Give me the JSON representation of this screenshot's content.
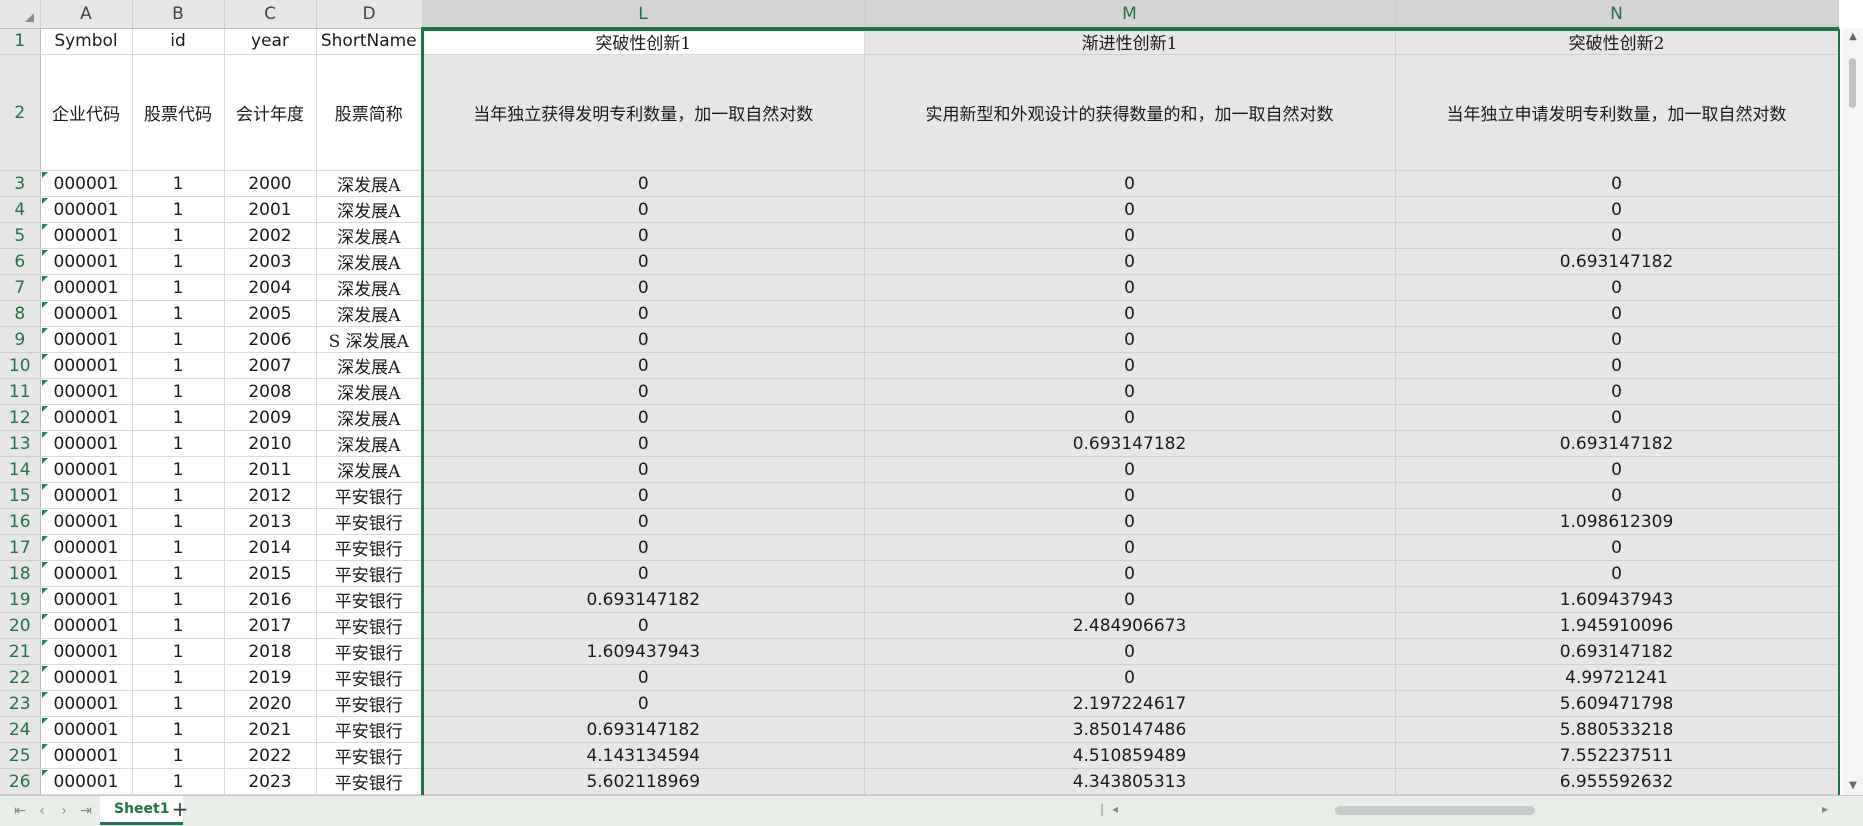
{
  "columns": [
    "A",
    "B",
    "C",
    "D",
    "L",
    "M",
    "N"
  ],
  "header_row_1": [
    "Symbol",
    "id",
    "year",
    "ShortName",
    "突破性创新1",
    "渐进性创新1",
    "突破性创新2"
  ],
  "header_row_2": [
    "企业代码",
    "股票代码",
    "会计年度",
    "股票简称",
    "当年独立获得发明专利数量，加一取自然对数",
    "实用新型和外观设计的获得数量的和，加一取自然对数",
    "当年独立申请发明专利数量，加一取自然对数"
  ],
  "row_numbers": [
    "1",
    "2",
    "3",
    "4",
    "5",
    "6",
    "7",
    "8",
    "9",
    "10",
    "11",
    "12",
    "13",
    "14",
    "15",
    "16",
    "17",
    "18",
    "19",
    "20",
    "21",
    "22",
    "23",
    "24",
    "25",
    "26"
  ],
  "rows": [
    [
      "000001",
      "1",
      "2000",
      "深发展A",
      "0",
      "0",
      "0"
    ],
    [
      "000001",
      "1",
      "2001",
      "深发展A",
      "0",
      "0",
      "0"
    ],
    [
      "000001",
      "1",
      "2002",
      "深发展A",
      "0",
      "0",
      "0"
    ],
    [
      "000001",
      "1",
      "2003",
      "深发展A",
      "0",
      "0",
      "0.693147182"
    ],
    [
      "000001",
      "1",
      "2004",
      "深发展A",
      "0",
      "0",
      "0"
    ],
    [
      "000001",
      "1",
      "2005",
      "深发展A",
      "0",
      "0",
      "0"
    ],
    [
      "000001",
      "1",
      "2006",
      "S 深发展A",
      "0",
      "0",
      "0"
    ],
    [
      "000001",
      "1",
      "2007",
      "深发展A",
      "0",
      "0",
      "0"
    ],
    [
      "000001",
      "1",
      "2008",
      "深发展A",
      "0",
      "0",
      "0"
    ],
    [
      "000001",
      "1",
      "2009",
      "深发展A",
      "0",
      "0",
      "0"
    ],
    [
      "000001",
      "1",
      "2010",
      "深发展A",
      "0",
      "0.693147182",
      "0.693147182"
    ],
    [
      "000001",
      "1",
      "2011",
      "深发展A",
      "0",
      "0",
      "0"
    ],
    [
      "000001",
      "1",
      "2012",
      "平安银行",
      "0",
      "0",
      "0"
    ],
    [
      "000001",
      "1",
      "2013",
      "平安银行",
      "0",
      "0",
      "1.098612309"
    ],
    [
      "000001",
      "1",
      "2014",
      "平安银行",
      "0",
      "0",
      "0"
    ],
    [
      "000001",
      "1",
      "2015",
      "平安银行",
      "0",
      "0",
      "0"
    ],
    [
      "000001",
      "1",
      "2016",
      "平安银行",
      "0.693147182",
      "0",
      "1.609437943"
    ],
    [
      "000001",
      "1",
      "2017",
      "平安银行",
      "0",
      "2.484906673",
      "1.945910096"
    ],
    [
      "000001",
      "1",
      "2018",
      "平安银行",
      "1.609437943",
      "0",
      "0.693147182"
    ],
    [
      "000001",
      "1",
      "2019",
      "平安银行",
      "0",
      "0",
      "4.99721241"
    ],
    [
      "000001",
      "1",
      "2020",
      "平安银行",
      "0",
      "2.197224617",
      "5.609471798"
    ],
    [
      "000001",
      "1",
      "2021",
      "平安银行",
      "0.693147182",
      "3.850147486",
      "5.880533218"
    ],
    [
      "000001",
      "1",
      "2022",
      "平安银行",
      "4.143134594",
      "4.510859489",
      "7.552237511"
    ],
    [
      "000001",
      "1",
      "2023",
      "平安银行",
      "5.602118969",
      "4.343805313",
      "6.955592632"
    ]
  ],
  "sheet_tab": "Sheet1",
  "add_sheet_icon": "+",
  "nav_icons": [
    "⇤",
    "‹",
    "›",
    "⇥"
  ],
  "colors": {
    "accent": "#217346",
    "header_bg": "#e6e6e6",
    "selection_bg": "#e6e6e6"
  }
}
